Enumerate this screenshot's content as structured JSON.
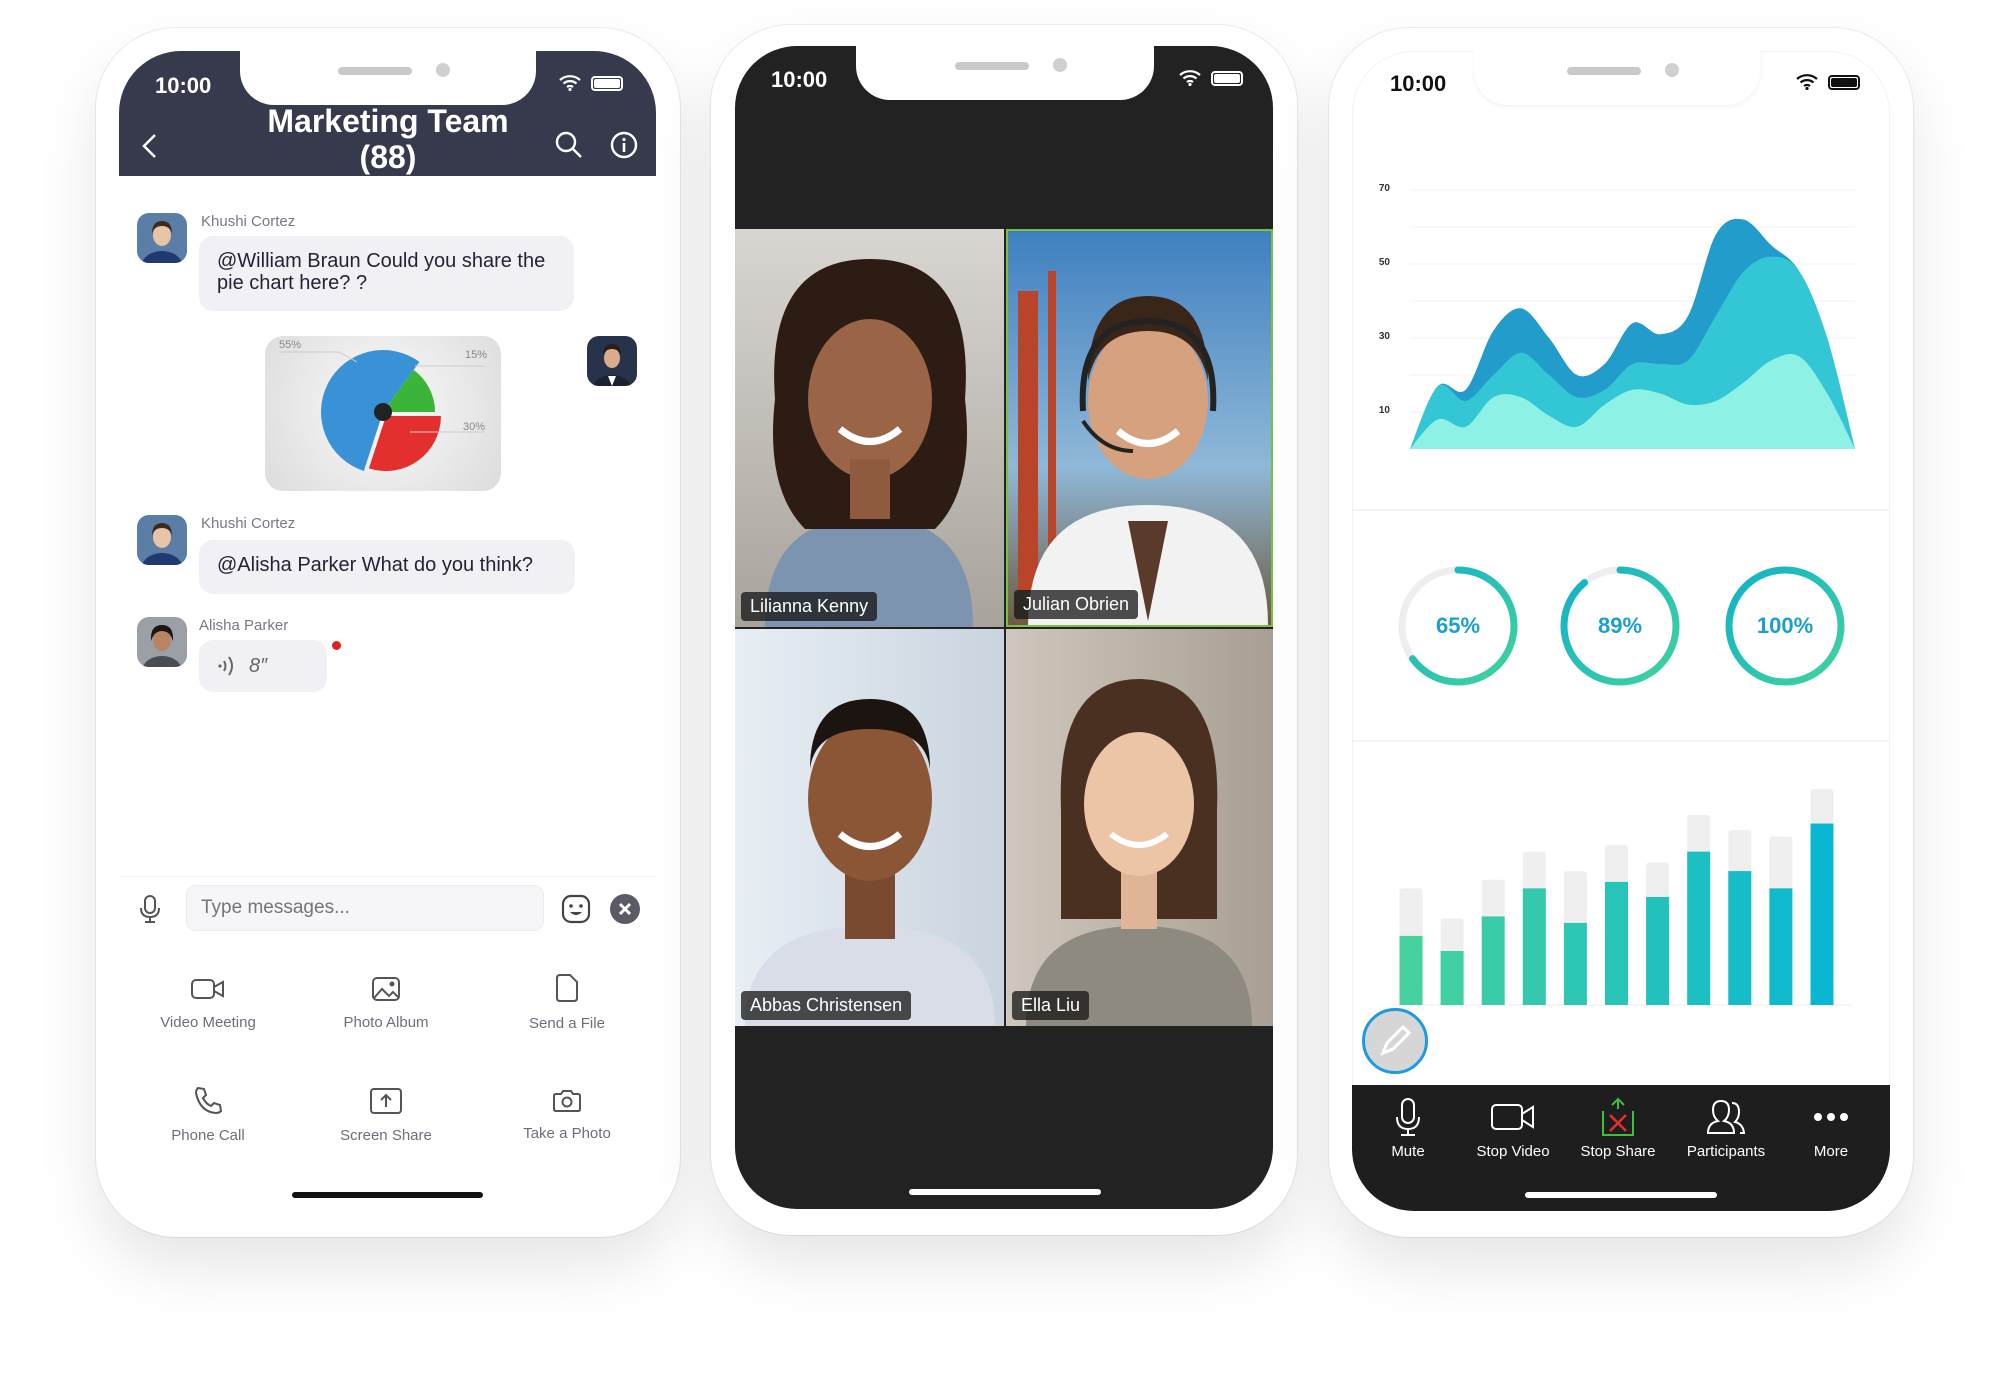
{
  "status_time": "10:00",
  "chat": {
    "title": "Marketing Team (88)",
    "messages": [
      {
        "sender": "Khushi Cortez",
        "text": "@William Braun Could you share the pie chart here? ?"
      },
      {
        "sender": "Khushi Cortez",
        "text": "@Alisha Parker What do you think?"
      },
      {
        "sender": "Alisha Parker",
        "voice_duration": "8″"
      }
    ],
    "pie_image": {
      "labels": [
        "55%",
        "15%",
        "30%"
      ],
      "values": [
        55,
        15,
        30
      ],
      "colors": [
        "#3a92d6",
        "#3ab53a",
        "#e3302e"
      ]
    },
    "input_placeholder": "Type messages...",
    "actions": [
      {
        "label": "Video Meeting",
        "icon": "video-camera-icon"
      },
      {
        "label": "Photo Album",
        "icon": "image-icon"
      },
      {
        "label": "Send a File",
        "icon": "file-icon"
      },
      {
        "label": "Phone Call",
        "icon": "phone-icon"
      },
      {
        "label": "Screen Share",
        "icon": "screen-share-icon"
      },
      {
        "label": "Take a Photo",
        "icon": "camera-icon"
      }
    ]
  },
  "video": {
    "participants": [
      {
        "name": "Lilianna Kenny"
      },
      {
        "name": "Julian Obrien",
        "active_speaker": true
      },
      {
        "name": "Abbas Christensen"
      },
      {
        "name": "Ella Liu"
      }
    ],
    "active_color": "#7ac143"
  },
  "stats": {
    "chart_data": [
      {
        "type": "area",
        "yticks": [
          10,
          30,
          50,
          70
        ],
        "ylim": [
          0,
          70
        ],
        "grid": true,
        "x": [
          0,
          1,
          2,
          3,
          4,
          5,
          6,
          7,
          8,
          9,
          10,
          11,
          12,
          13,
          14,
          15,
          16
        ],
        "series": [
          {
            "color": "#229ccb",
            "values": [
              0,
              17,
              16,
              32,
              38,
              30,
              20,
              23,
              34,
              31,
              36,
              58,
              62,
              55,
              48,
              30,
              0
            ]
          },
          {
            "color": "#33c6d4",
            "values": [
              0,
              17,
              13,
              20,
              26,
              20,
              14,
              16,
              23,
              23,
              24,
              36,
              48,
              52,
              48,
              30,
              0
            ]
          },
          {
            "color": "#8ef1e5",
            "values": [
              0,
              8,
              6,
              14,
              14,
              9,
              6,
              12,
              16,
              15,
              12,
              13,
              18,
              24,
              25,
              15,
              0
            ]
          }
        ]
      },
      {
        "type": "bar",
        "values": [
          32,
          25,
          41,
          54,
          38,
          57,
          50,
          71,
          62,
          54,
          84
        ],
        "totals": [
          54,
          40,
          58,
          71,
          62,
          74,
          66,
          88,
          81,
          78,
          100
        ],
        "colors": [
          "#46d19e",
          "#0ab7d2"
        ]
      }
    ],
    "rings": [
      {
        "label": "65%",
        "value": 65
      },
      {
        "label": "89%",
        "value": 89
      },
      {
        "label": "100%",
        "value": 100
      }
    ],
    "toolbar": [
      {
        "label": "Mute",
        "icon": "microphone-icon"
      },
      {
        "label": "Stop Video",
        "icon": "video-camera-icon"
      },
      {
        "label": "Stop Share",
        "icon": "stop-share-icon"
      },
      {
        "label": "Participants",
        "icon": "participants-icon"
      },
      {
        "label": "More",
        "icon": "more-icon"
      }
    ]
  }
}
